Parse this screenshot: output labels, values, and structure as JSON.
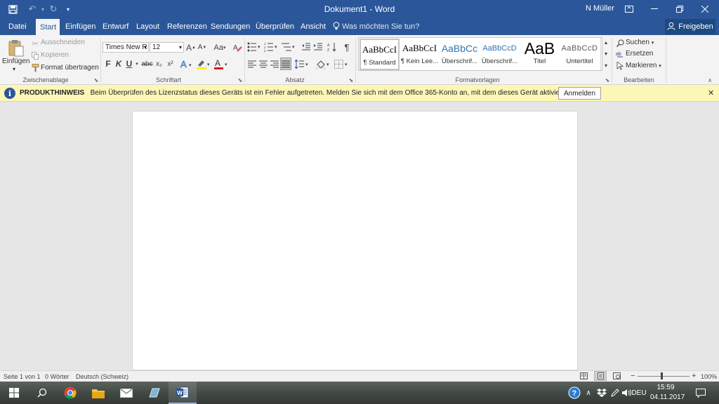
{
  "title": {
    "document": "Dokument1",
    "separator": "-",
    "app": "Word",
    "user": "N Müller"
  },
  "tabs": [
    {
      "label": "Datei"
    },
    {
      "label": "Start"
    },
    {
      "label": "Einfügen"
    },
    {
      "label": "Entwurf"
    },
    {
      "label": "Layout"
    },
    {
      "label": "Referenzen"
    },
    {
      "label": "Sendungen"
    },
    {
      "label": "Überprüfen"
    },
    {
      "label": "Ansicht"
    }
  ],
  "tell_me": "Was möchten Sie tun?",
  "share": "Freigeben",
  "clipboard": {
    "paste": "Einfügen",
    "cut": "Ausschneiden",
    "copy": "Kopieren",
    "format_painter": "Format übertragen",
    "group": "Zwischenablage"
  },
  "font": {
    "name": "Times New R",
    "size": "12",
    "bold": "F",
    "italic": "K",
    "underline": "U",
    "strike": "abc",
    "subscript": "x₂",
    "superscript": "x²",
    "case": "Aa",
    "grow": "A",
    "shrink": "A",
    "group": "Schriftart"
  },
  "paragraph": {
    "group": "Absatz",
    "pilcrow": "¶"
  },
  "styles": {
    "group": "Formatvorlagen",
    "items": [
      {
        "preview": "AaBbCcI",
        "name": "¶ Standard"
      },
      {
        "preview": "AaBbCcI",
        "name": "¶ Kein Lee..."
      },
      {
        "preview": "AaBbCc",
        "name": "Überschrif..."
      },
      {
        "preview": "AaBbCcD",
        "name": "Überschrif..."
      },
      {
        "preview": "AaB",
        "name": "Titel"
      },
      {
        "preview": "AaBbCcD",
        "name": "Untertitel"
      }
    ]
  },
  "editing": {
    "find": "Suchen",
    "replace": "Ersetzen",
    "select": "Markieren",
    "group": "Bearbeiten"
  },
  "infobar": {
    "title": "PRODUKTHINWEIS",
    "message": "Beim Überprüfen des Lizenzstatus dieses Geräts ist ein Fehler aufgetreten. Melden Sie sich mit dem Office 365-Konto an, mit dem dieses Gerät aktiviert wurde.",
    "button": "Anmelden"
  },
  "status": {
    "page": "Seite 1 von 1",
    "words": "0 Wörter",
    "language": "Deutsch (Schweiz)",
    "zoom": "100%",
    "zoom_minus": "−",
    "zoom_plus": "+"
  },
  "taskbar": {
    "language": "DEU",
    "time": "15:59",
    "date": "04.11.2017"
  },
  "colors": {
    "brand": "#2b579a",
    "infobar": "#fcf7b6",
    "font_color": "#e81123",
    "highlight": "#fff200"
  }
}
